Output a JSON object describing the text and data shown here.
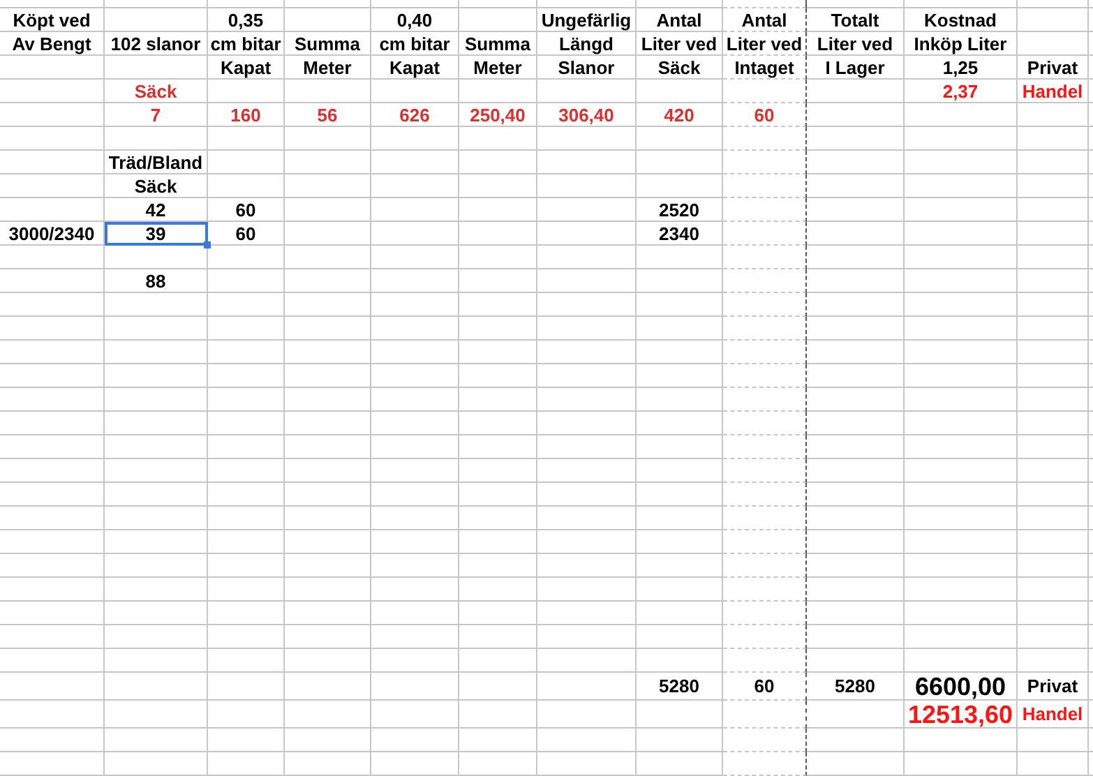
{
  "rows": [
    {
      "cells": {
        "column_1": "Köpt ved",
        "column_3": "0,35",
        "column_5": "0,40",
        "column_7": "Ungefärlig",
        "column_8": "Antal",
        "column_9": "Antal",
        "column_10": "Totalt",
        "column_11": "Kostnad"
      }
    },
    {
      "cells": {
        "column_1": "Av Bengt",
        "column_2": "102 slanor",
        "column_3": "cm bitar",
        "column_4": "Summa",
        "column_5": "cm bitar",
        "column_6": "Summa",
        "column_7": "Längd",
        "column_8": "Liter ved",
        "column_9": "Liter ved",
        "column_10": "Liter ved",
        "column_11": "Inköp Liter"
      }
    },
    {
      "cells": {
        "column_3": "Kapat",
        "column_4": "Meter",
        "column_5": "Kapat",
        "column_6": "Meter",
        "column_7": "Slanor",
        "column_8": "Säck",
        "column_9": "Intaget",
        "column_10": "I Lager",
        "column_11": "1,25",
        "column_12": "Privat"
      }
    },
    {
      "cells": {
        "column_2": {
          "text": "Säck",
          "color": "#d93131"
        },
        "column_11": {
          "text": "2,37",
          "color": "#ff1414"
        },
        "column_12": {
          "text": "Handel",
          "color": "#ff1414"
        }
      }
    },
    {
      "cells": {
        "column_2": {
          "text": "7",
          "color": "#d93131"
        },
        "column_3": {
          "text": "160",
          "color": "#d93131"
        },
        "column_4": {
          "text": "56",
          "color": "#d93131"
        },
        "column_5": {
          "text": "626",
          "color": "#d93131"
        },
        "column_6": {
          "text": "250,40",
          "color": "#d93131"
        },
        "column_7": {
          "text": "306,40",
          "color": "#d93131"
        },
        "column_8": {
          "text": "420",
          "color": "#d93131"
        },
        "column_9": {
          "text": "60",
          "color": "#d93131"
        }
      }
    },
    {},
    {
      "cells": {
        "column_2": "Träd/Bland"
      }
    },
    {
      "cells": {
        "column_2": "Säck"
      }
    },
    {
      "cells": {
        "column_2": "42",
        "column_3": "60",
        "column_8": "2520"
      }
    },
    {
      "cells": {
        "column_1": "3000/2340",
        "column_2": {
          "text": "39",
          "selected": true
        },
        "column_3": "60",
        "column_8": "2340"
      }
    },
    {},
    {
      "cells": {
        "column_2": "88"
      }
    },
    {},
    {},
    {},
    {},
    {},
    {},
    {},
    {},
    {},
    {},
    {},
    {},
    {},
    {},
    {},
    {},
    {
      "cells": {
        "column_8": "5280",
        "column_9": "60",
        "column_10": "5280",
        "column_11": {
          "text": "6600,00",
          "kind": "large"
        },
        "column_12": "Privat"
      }
    },
    {
      "cells": {
        "column_11": {
          "text": "12513,60",
          "kind": "large",
          "color": "#ff1414"
        },
        "column_12": {
          "text": "Handel",
          "color": "#ff1414"
        }
      }
    },
    {},
    {}
  ]
}
